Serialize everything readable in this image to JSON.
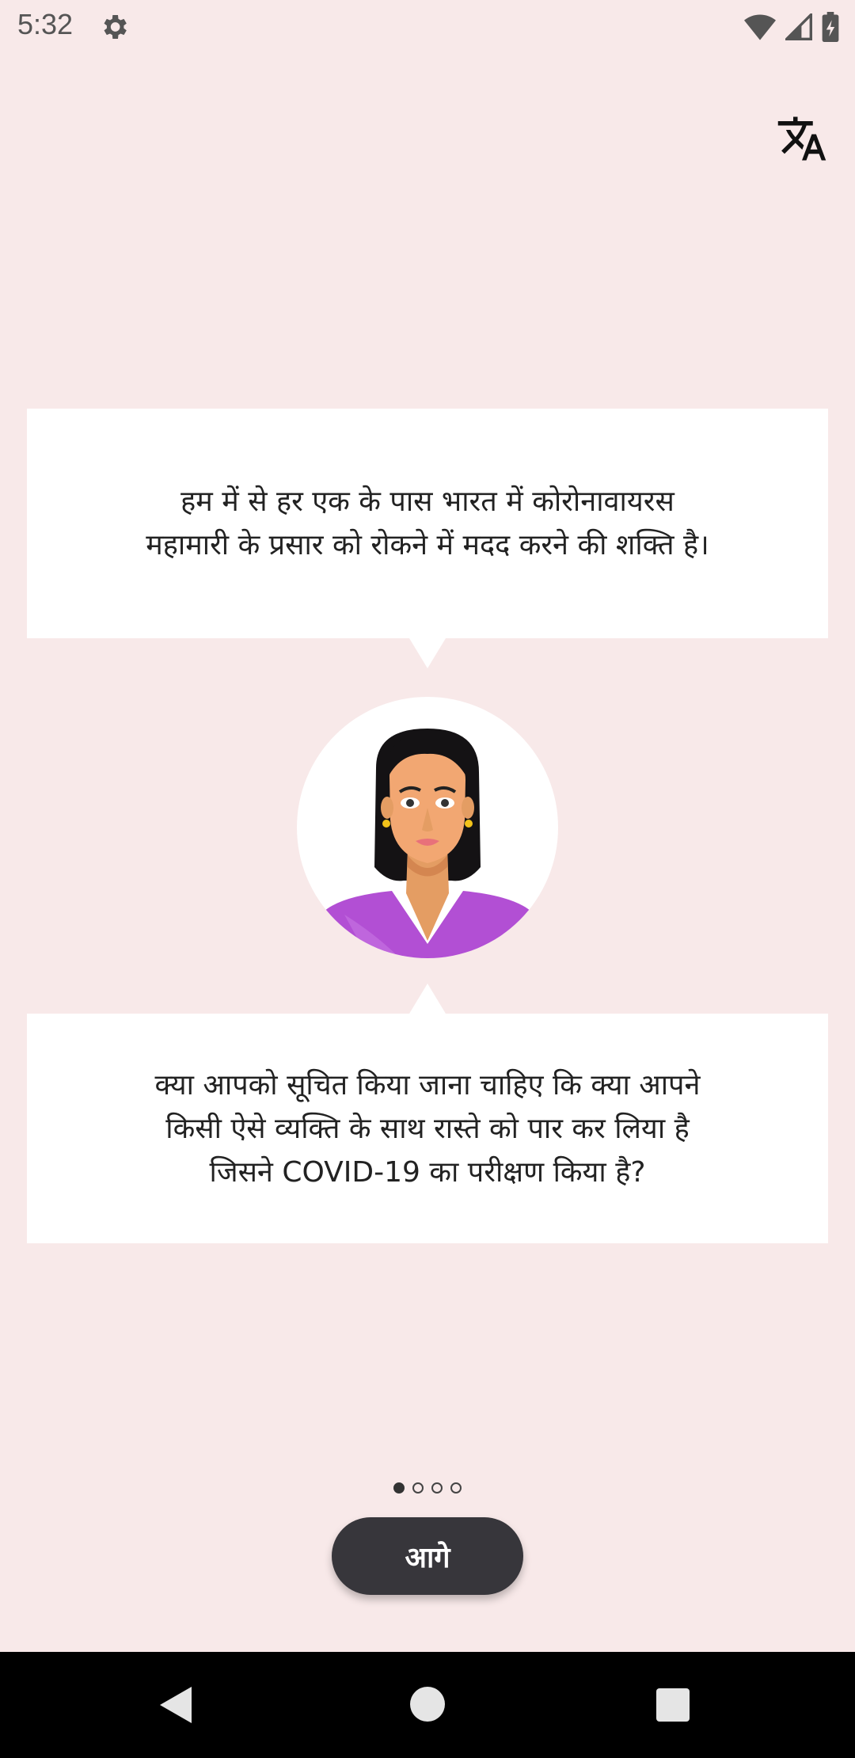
{
  "status_bar": {
    "time": "5:32",
    "icons": [
      "gear-icon",
      "wifi-icon",
      "signal-icon",
      "battery-icon"
    ]
  },
  "toolbar": {
    "translate_icon": "translate-icon"
  },
  "messages": {
    "top": "हम में से हर एक के पास भारत में कोरोनावायरस महामारी के प्रसार को रोकने में मदद करने की शक्ति है।",
    "bottom": "क्या आपको सूचित किया जाना चाहिए कि क्या आपने किसी ऐसे व्यक्ति के साथ रास्ते को पार कर लिया है जिसने COVID-19 का परीक्षण किया है?"
  },
  "pager": {
    "total": 4,
    "active_index": 0
  },
  "next_button": {
    "label": "आगे"
  },
  "colors": {
    "background": "#f8e9e9",
    "card": "#ffffff",
    "button": "#37363b",
    "avatar_shirt": "#b24fd4"
  }
}
